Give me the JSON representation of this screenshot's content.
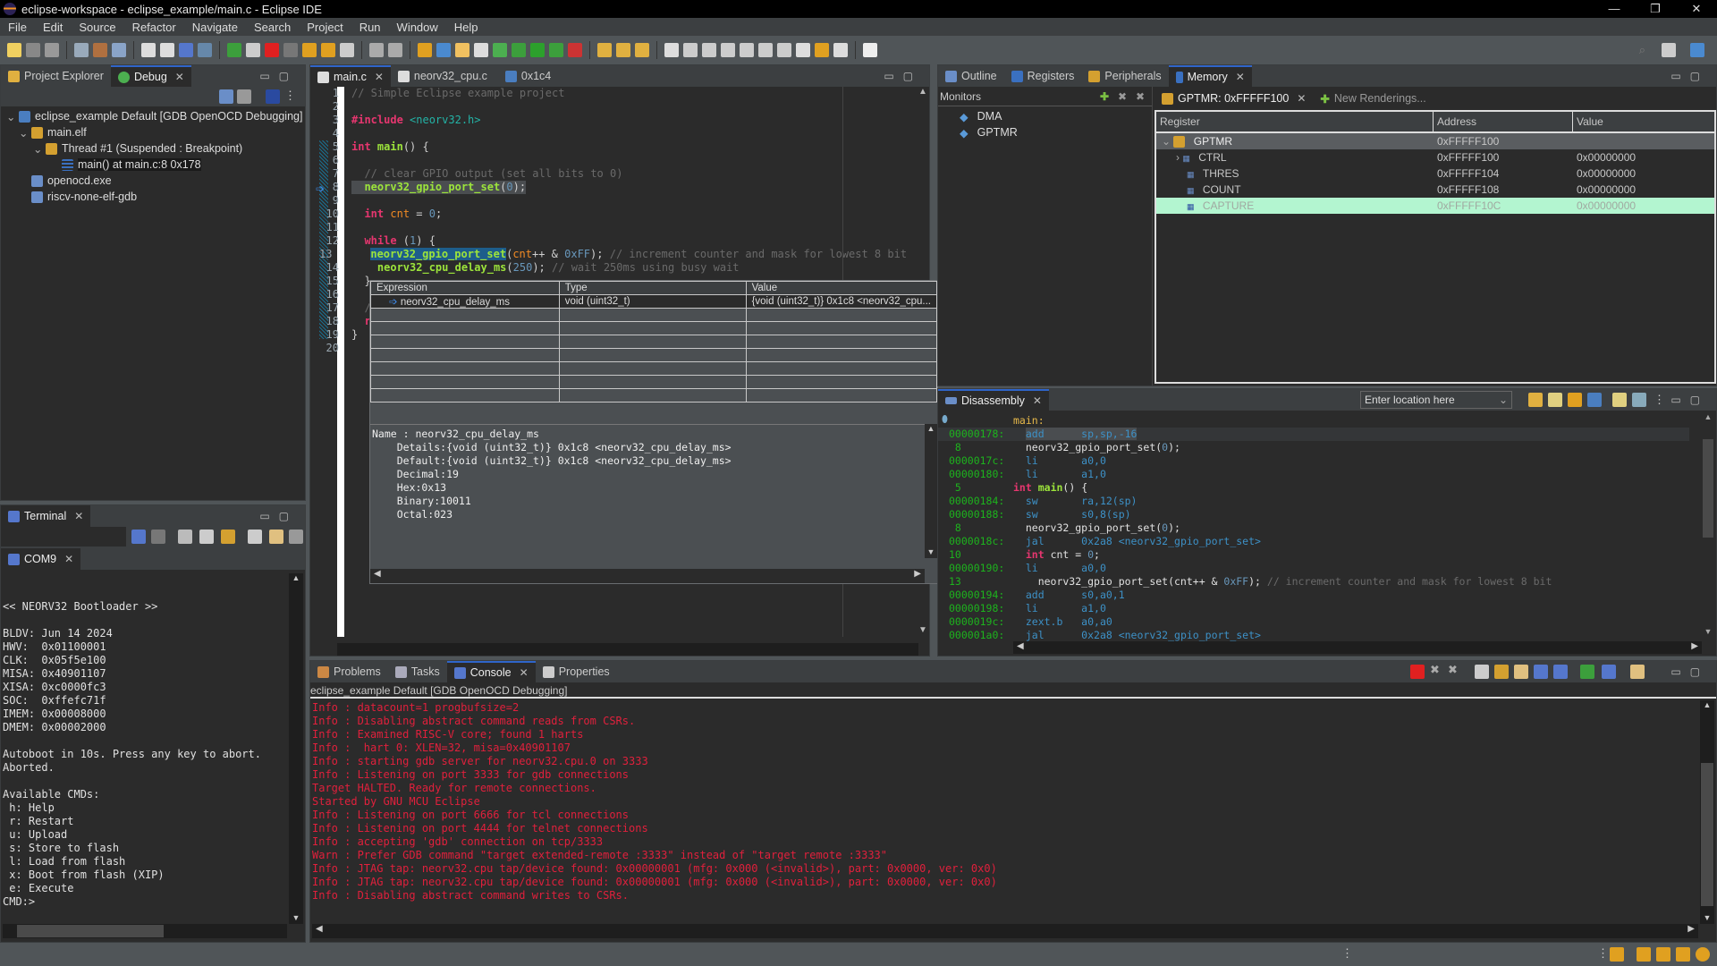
{
  "window": {
    "title": "eclipse-workspace - eclipse_example/main.c - Eclipse IDE",
    "controls": [
      "—",
      "❐",
      "✕"
    ]
  },
  "menu": [
    "File",
    "Edit",
    "Source",
    "Refactor",
    "Navigate",
    "Search",
    "Project",
    "Run",
    "Window",
    "Help"
  ],
  "debug_view": {
    "tabs": [
      {
        "label": "Project Explorer",
        "icon": "project-explorer-icon",
        "active": false
      },
      {
        "label": "Debug",
        "icon": "bug-icon",
        "active": true
      }
    ],
    "tree": [
      {
        "label": "eclipse_example Default [GDB OpenOCD Debugging]",
        "level": 0,
        "expanded": true,
        "icon": "c-launch-icon"
      },
      {
        "label": "main.elf",
        "level": 1,
        "expanded": true,
        "icon": "process-icon"
      },
      {
        "label": "Thread #1 (Suspended : Breakpoint)",
        "level": 2,
        "expanded": true,
        "icon": "thread-icon"
      },
      {
        "label": "main() at main.c:8 0x178",
        "level": 3,
        "icon": "stack-frame-icon"
      },
      {
        "label": "openocd.exe",
        "level": 1,
        "icon": "process-icon"
      },
      {
        "label": "riscv-none-elf-gdb",
        "level": 1,
        "icon": "process-icon"
      }
    ]
  },
  "editor": {
    "tabs": [
      {
        "label": "main.c",
        "active": true,
        "closable": true
      },
      {
        "label": "neorv32_cpu.c",
        "active": false,
        "closable": false
      },
      {
        "label": "0x1c4",
        "active": false,
        "closable": false
      }
    ],
    "lines": [
      {
        "n": "1",
        "html": "<span class='cm'>// Simple Eclipse example project</span>"
      },
      {
        "n": "2",
        "html": ""
      },
      {
        "n": "3",
        "html": "<span class='kw'>#include</span> <span class='inc'>&lt;neorv32.h&gt;</span>"
      },
      {
        "n": "4",
        "html": ""
      },
      {
        "n": "5",
        "html": "<span class='kw'>int</span> <span class='fn'>main</span>() {"
      },
      {
        "n": "6",
        "html": ""
      },
      {
        "n": "7",
        "html": "  <span class='cm'>// clear GPIO output (set all bits to 0)</span>"
      },
      {
        "n": "8",
        "html": "  <span class='fn'>neorv32_gpio_port_set</span>(<span class='num'>0</span>);",
        "current": true
      },
      {
        "n": "9",
        "html": ""
      },
      {
        "n": "10",
        "html": "  <span class='kw'>int</span> <span class='var'>cnt</span> = <span class='num'>0</span>;"
      },
      {
        "n": "11",
        "html": ""
      },
      {
        "n": "12",
        "html": "  <span class='kw'>while</span> (<span class='num'>1</span>) {"
      },
      {
        "n": "13",
        "html": "    <span class='fn' style='background:#1d5d8b'>neorv32_gpio_port_set</span>(<span class='var'>cnt</span>++ &amp; <span class='num'>0xFF</span>); <span class='cm'>// increment counter and mask for lowest 8 bit</span>"
      },
      {
        "n": "14",
        "html": "    <span class='fn'>neorv32_cpu_delay_ms</span>(<span class='num'>250</span>); <span class='cm'>// wait 250ms using busy wait</span>"
      },
      {
        "n": "15",
        "html": "  }"
      },
      {
        "n": "16",
        "html": ""
      },
      {
        "n": "17",
        "html": "  <span class='cm'>//</span>"
      },
      {
        "n": "18",
        "html": "  <span class='kw'>re</span>"
      },
      {
        "n": "19",
        "html": "}"
      },
      {
        "n": "20",
        "html": ""
      }
    ],
    "hover": {
      "columns": [
        "Expression",
        "Type",
        "Value"
      ],
      "rows": [
        {
          "expression": "neorv32_cpu_delay_ms",
          "type": "void (uint32_t)",
          "value": "{void (uint32_t)} 0x1c8 <neorv32_cpu..."
        }
      ],
      "details": [
        "Name : neorv32_cpu_delay_ms",
        "    Details:{void (uint32_t)} 0x1c8 <neorv32_cpu_delay_ms>",
        "    Default:{void (uint32_t)} 0x1c8 <neorv32_cpu_delay_ms>",
        "    Decimal:19",
        "    Hex:0x13",
        "    Binary:10011",
        "    Octal:023"
      ]
    }
  },
  "right_view": {
    "tabs": [
      {
        "label": "Outline",
        "active": false
      },
      {
        "label": "Registers",
        "active": false
      },
      {
        "label": "Peripherals",
        "active": false
      },
      {
        "label": "Memory",
        "active": true
      }
    ],
    "monitors": {
      "title": "Monitors",
      "items": [
        "DMA",
        "GPTMR"
      ]
    },
    "rendering_tab": "GPTMR: 0xFFFFF100",
    "new_renderings": "New Renderings...",
    "columns": [
      "Register",
      "Address",
      "Value"
    ],
    "rows": [
      {
        "name": "GPTMR",
        "address": "0xFFFFF100",
        "value": "",
        "group": true
      },
      {
        "name": "CTRL",
        "address": "0xFFFFF100",
        "value": "0x00000000",
        "expandable": true
      },
      {
        "name": "THRES",
        "address": "0xFFFFF104",
        "value": "0x00000000"
      },
      {
        "name": "COUNT",
        "address": "0xFFFFF108",
        "value": "0x00000000"
      },
      {
        "name": "CAPTURE",
        "address": "0xFFFFF10C",
        "value": "0x00000000",
        "selected": true
      }
    ]
  },
  "disassembly": {
    "tab": "Disassembly",
    "location_placeholder": "Enter location here",
    "lines": [
      {
        "addr": "",
        "html": "<span style='color:#e8b94a'>main:</span>"
      },
      {
        "addr": "00000178:",
        "html": "  <span class='op' style='background:#4a4d50'>add      sp,sp,-16</span>",
        "current": true
      },
      {
        "addr": " 8",
        "html": "  neorv32_gpio_port_set(<span class='num'>0</span>);"
      },
      {
        "addr": "0000017c:",
        "html": "  <span class='op'>li       a0,0</span>"
      },
      {
        "addr": "00000180:",
        "html": "  <span class='op'>li       a1,0</span>"
      },
      {
        "addr": " 5",
        "html": "<span class='kw'>int</span> <span class='fn'>main</span>() {"
      },
      {
        "addr": "00000184:",
        "html": "  <span class='op'>sw       ra,12(sp)</span>"
      },
      {
        "addr": "00000188:",
        "html": "  <span class='op'>sw       s0,8(sp)</span>"
      },
      {
        "addr": " 8",
        "html": "  neorv32_gpio_port_set(<span class='num'>0</span>);"
      },
      {
        "addr": "0000018c:",
        "html": "  <span class='op'>jal      0x2a8 &lt;neorv32_gpio_port_set&gt;</span>"
      },
      {
        "addr": "10",
        "html": "  <span class='kw'>int</span> cnt = <span class='num'>0</span>;"
      },
      {
        "addr": "00000190:",
        "html": "  <span class='op'>li       a0,0</span>"
      },
      {
        "addr": "13",
        "html": "    neorv32_gpio_port_set(cnt++ &amp; <span class='num'>0xFF</span>); <span class='cm'>// increment counter and mask for lowest 8 bit</span>"
      },
      {
        "addr": "00000194:",
        "html": "  <span class='op'>add      s0,a0,1</span>"
      },
      {
        "addr": "00000198:",
        "html": "  <span class='op'>li       a1,0</span>"
      },
      {
        "addr": "0000019c:",
        "html": "  <span class='op'>zext.b   a0,a0</span>"
      },
      {
        "addr": "000001a0:",
        "html": "  <span class='op'>jal      0x2a8 &lt;neorv32_gpio_port_set&gt;</span>"
      }
    ]
  },
  "terminal": {
    "tab": "Terminal",
    "session_tab": "COM9",
    "lines": [
      "",
      "",
      "<< NEORV32 Bootloader >>",
      "",
      "BLDV: Jun 14 2024",
      "HWV:  0x01100001",
      "CLK:  0x05f5e100",
      "MISA: 0x40901107",
      "XISA: 0xc0000fc3",
      "SOC:  0xffefc71f",
      "IMEM: 0x00008000",
      "DMEM: 0x00002000",
      "",
      "Autoboot in 10s. Press any key to abort.",
      "Aborted.",
      "",
      "Available CMDs:",
      " h: Help",
      " r: Restart",
      " u: Upload",
      " s: Store to flash",
      " l: Load from flash",
      " x: Boot from flash (XIP)",
      " e: Execute",
      "CMD:>"
    ]
  },
  "console": {
    "tabs": [
      {
        "label": "Problems",
        "active": false
      },
      {
        "label": "Tasks",
        "active": false
      },
      {
        "label": "Console",
        "active": true
      },
      {
        "label": "Properties",
        "active": false
      }
    ],
    "header": "eclipse_example Default [GDB OpenOCD Debugging]",
    "lines": [
      "Info : datacount=1 progbufsize=2",
      "Info : Disabling abstract command reads from CSRs.",
      "Info : Examined RISC-V core; found 1 harts",
      "Info :  hart 0: XLEN=32, misa=0x40901107",
      "Info : starting gdb server for neorv32.cpu.0 on 3333",
      "Info : Listening on port 3333 for gdb connections",
      "Target HALTED. Ready for remote connections.",
      "Started by GNU MCU Eclipse",
      "Info : Listening on port 6666 for tcl connections",
      "Info : Listening on port 4444 for telnet connections",
      "Info : accepting 'gdb' connection on tcp/3333",
      "Warn : Prefer GDB command \"target extended-remote :3333\" instead of \"target remote :3333\"",
      "Info : JTAG tap: neorv32.cpu tap/device found: 0x00000001 (mfg: 0x000 (<invalid>), part: 0x0000, ver: 0x0)",
      "Info : JTAG tap: neorv32.cpu tap/device found: 0x00000001 (mfg: 0x000 (<invalid>), part: 0x0000, ver: 0x0)",
      "Info : Disabling abstract command writes to CSRs."
    ]
  },
  "colors": {
    "console_error": "#e0203c",
    "address_green": "#1db31d",
    "selected_row": "#b3f5d0",
    "accent_blue": "#2f65ca"
  }
}
